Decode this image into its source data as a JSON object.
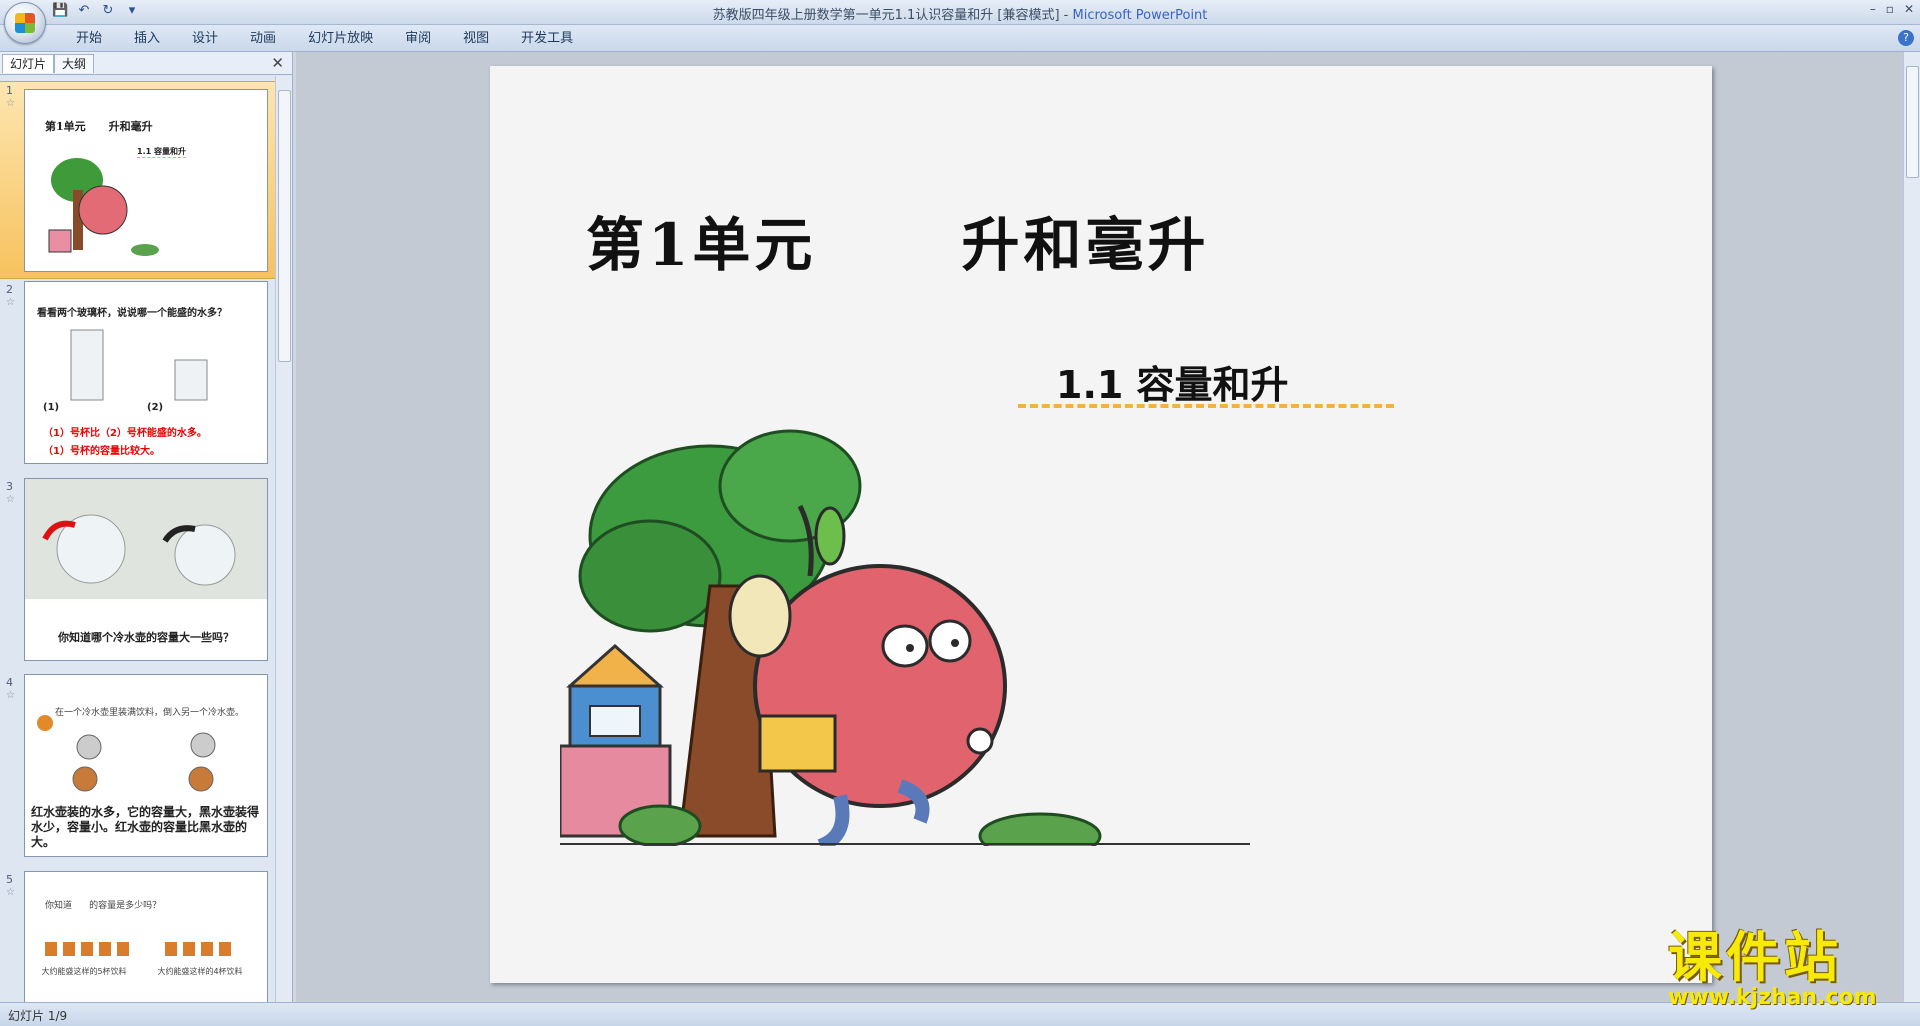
{
  "window": {
    "title": "苏教版四年级上册数学第一单元1.1认识容量和升 [兼容模式]",
    "app_name": "Microsoft PowerPoint",
    "minimize": "–",
    "restore": "▫",
    "close": "✕"
  },
  "ribbon": {
    "tabs": [
      "开始",
      "插入",
      "设计",
      "动画",
      "幻灯片放映",
      "审阅",
      "视图",
      "开发工具"
    ],
    "help": "?"
  },
  "panel": {
    "tab_slides": "幻灯片",
    "tab_outline": "大纲",
    "close": "✕"
  },
  "thumbnails": [
    {
      "num": "1",
      "title": "第1单元      升和毫升",
      "sub": "1.1 容量和升"
    },
    {
      "num": "2",
      "question": "看看两个玻璃杯，说说哪一个能盛的水多？",
      "label1": "(1)",
      "label2": "(2)",
      "line1": "（1）号杯比（2）号杯能盛的水多。",
      "line2": "（1）号杯的容量比较大。"
    },
    {
      "num": "3",
      "question": "你知道哪个冷水壶的容量大一些吗？"
    },
    {
      "num": "4",
      "top": "在一个冷水壶里装满饮料，倒入另一个冷水壶。",
      "text": "红水壶装的水多，它的容量大，黑水壶装得水少，容量小。红水壶的容量比黑水壶的大。"
    },
    {
      "num": "5",
      "top": "你知道      的容量是多少吗？",
      "a": "大约能盛这样的5杯饮料",
      "b": "大约能盛这样的4杯饮料"
    }
  ],
  "slide": {
    "title": "第1单元      升和毫升",
    "subtitle": "1.1  容量和升"
  },
  "status": {
    "slide_info": "幻灯片 1/9"
  },
  "watermark": {
    "line1": "课件站",
    "line2": "www.kjzhan.com"
  },
  "colors": {
    "selected_thumb": "#f7c25e",
    "dash": "#f0b33b",
    "watermark": "#f5ea0a"
  }
}
